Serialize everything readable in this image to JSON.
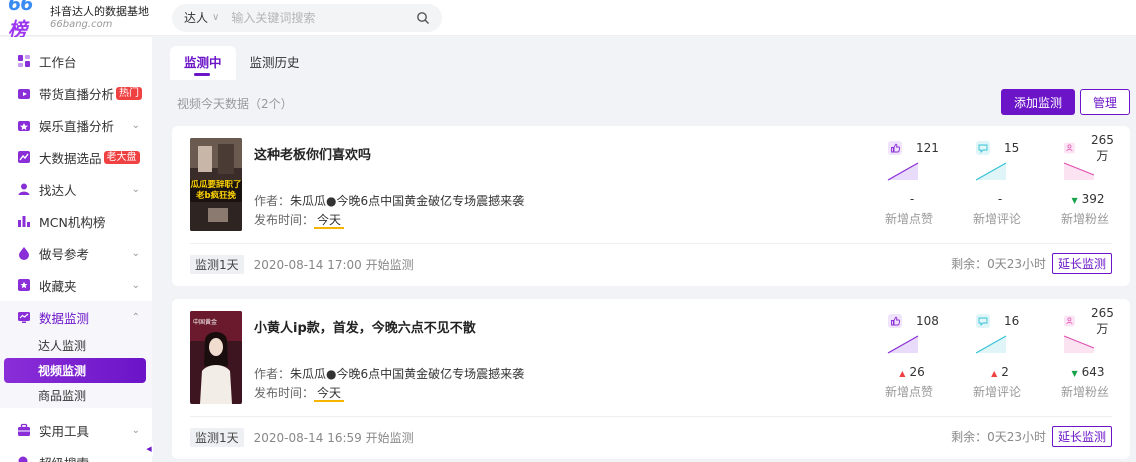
{
  "brand": {
    "logo_text": "66榜",
    "tagline": "抖音达人的数据基地",
    "domain": "66bang.com"
  },
  "search": {
    "type": "达人",
    "placeholder": "输入关键词搜索"
  },
  "sidebar": {
    "items": [
      {
        "label": "工作台",
        "icon": "dashboard-icon"
      },
      {
        "label": "带货直播分析",
        "icon": "live-tv-icon",
        "badge": "热门"
      },
      {
        "label": "娱乐直播分析",
        "icon": "entertainment-icon",
        "chevron": true
      },
      {
        "label": "大数据选品",
        "icon": "bigdata-icon",
        "badge": "老大盘"
      },
      {
        "label": "找达人",
        "icon": "user-icon",
        "chevron": true
      },
      {
        "label": "MCN机构榜",
        "icon": "mcn-icon"
      },
      {
        "label": "做号参考",
        "icon": "reference-icon",
        "chevron": true
      },
      {
        "label": "收藏夹",
        "icon": "favorites-icon",
        "chevron": true
      },
      {
        "label": "数据监测",
        "icon": "monitor-icon",
        "chevron": true,
        "expanded": true
      },
      {
        "label": "实用工具",
        "icon": "tools-icon",
        "chevron": true
      },
      {
        "label": "超级搜索",
        "icon": "super-search-icon"
      }
    ],
    "monitor_sub": [
      "达人监测",
      "视频监测",
      "商品监测"
    ],
    "active_sub": "视频监测"
  },
  "tabs": [
    "监测中",
    "监测历史"
  ],
  "active_tab": "监测中",
  "subtitle": "视频今天数据（2个）",
  "buttons": {
    "add": "添加监测",
    "manage": "管理",
    "extend": "延长监测"
  },
  "labels": {
    "author_prefix": "作者：",
    "time_prefix": "发布时间：",
    "likes": "新增点赞",
    "comments": "新增评论",
    "fans": "新增粉丝"
  },
  "colors": {
    "accent": "#6b14c8",
    "up": "#f04142",
    "down": "#16a34a"
  },
  "videos": [
    {
      "title": "这种老板你们喜欢吗",
      "author": "朱瓜瓜●今晚6点中国黄金破亿专场震撼来袭",
      "publish_time": "今天",
      "likes": "121",
      "comments": "15",
      "fans": "265万",
      "likes_delta": "-",
      "comments_delta": "-",
      "fans_delta": "392",
      "fans_trend": "down",
      "tag": "监测1天",
      "start": "2020-08-14 17:00 开始监测",
      "remaining": "剩余：0天23小时",
      "thumb_text": "瓜瓜要辞职了 老b疯狂挽"
    },
    {
      "title": "小黄人ip款，首发，今晚六点不见不散",
      "author": "朱瓜瓜●今晚6点中国黄金破亿专场震撼来袭",
      "publish_time": "今天",
      "likes": "108",
      "comments": "16",
      "fans": "265万",
      "likes_delta": "26",
      "likes_trend": "up",
      "comments_delta": "2",
      "comments_trend": "up",
      "fans_delta": "643",
      "fans_trend": "down",
      "tag": "监测1天",
      "start": "2020-08-14 16:59 开始监测",
      "remaining": "剩余：0天23小时",
      "thumb_text": "中国黄金"
    }
  ]
}
